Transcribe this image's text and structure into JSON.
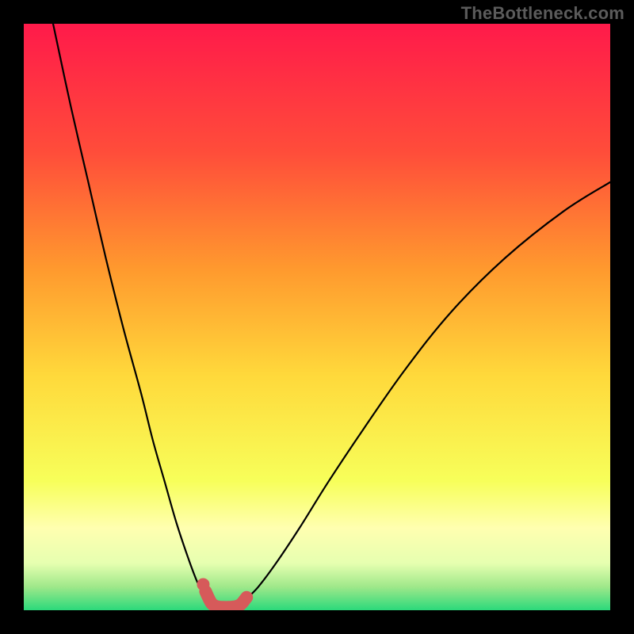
{
  "watermark": "TheBottleneck.com",
  "chart_data": {
    "type": "line",
    "title": "",
    "xlabel": "",
    "ylabel": "",
    "xlim": [
      0,
      100
    ],
    "ylim": [
      0,
      100
    ],
    "grid": false,
    "legend": false,
    "background_gradient": {
      "top": "#ff1a4a",
      "mid_upper": "#ff8a2a",
      "mid": "#ffe53b",
      "mid_lower": "#f7ff66",
      "band": "#ffffaa",
      "bottom": "#2bd97b"
    },
    "series": [
      {
        "name": "left-branch",
        "stroke": "#000000",
        "x": [
          5,
          8,
          11,
          14,
          17,
          20,
          22,
          24,
          26,
          28,
          29.5,
          30.5,
          31.5
        ],
        "y": [
          100,
          86,
          73,
          60,
          48,
          37,
          29,
          22,
          15,
          9,
          5,
          3,
          2
        ]
      },
      {
        "name": "right-branch",
        "stroke": "#000000",
        "x": [
          38,
          40,
          43,
          47,
          52,
          58,
          65,
          73,
          82,
          92,
          100
        ],
        "y": [
          2,
          4,
          8,
          14,
          22,
          31,
          41,
          51,
          60,
          68,
          73
        ]
      },
      {
        "name": "valley-dots",
        "stroke": "#d65a5a",
        "marker": "circle",
        "x": [
          31,
          32,
          33,
          34,
          35,
          36,
          37,
          38
        ],
        "y": [
          3.2,
          1.2,
          0.6,
          0.5,
          0.5,
          0.6,
          1.0,
          2.2
        ]
      }
    ]
  }
}
